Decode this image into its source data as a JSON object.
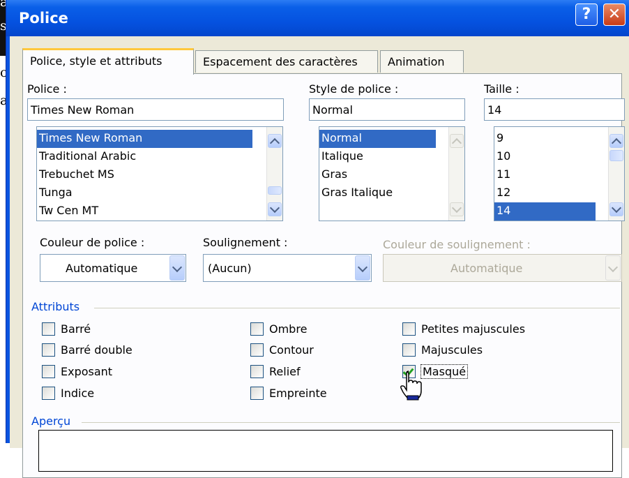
{
  "background": {
    "letters": [
      "a",
      "s",
      "c",
      "a"
    ]
  },
  "window": {
    "title": "Police",
    "help_glyph": "?",
    "close_glyph": "✕"
  },
  "tabs": [
    {
      "label": "Police, style et attributs",
      "active": true
    },
    {
      "label": "Espacement des caractères",
      "active": false
    },
    {
      "label": "Animation",
      "active": false
    }
  ],
  "font": {
    "label": "Police :",
    "value": "Times New Roman",
    "items": [
      "Times New Roman",
      "Traditional Arabic",
      "Trebuchet MS",
      "Tunga",
      "Tw Cen MT"
    ],
    "selected": "Times New Roman"
  },
  "style": {
    "label": "Style de police :",
    "value": "Normal",
    "items": [
      "Normal",
      "Italique",
      "Gras",
      "Gras Italique"
    ],
    "selected": "Normal"
  },
  "size": {
    "label": "Taille :",
    "value": "14",
    "items": [
      "9",
      "10",
      "11",
      "12",
      "14"
    ],
    "selected": "14"
  },
  "font_color": {
    "label": "Couleur de police :",
    "value": "Automatique"
  },
  "underline": {
    "label": "Soulignement :",
    "value": "(Aucun)"
  },
  "underline_color": {
    "label": "Couleur de soulignement :",
    "value": "Automatique",
    "disabled": true
  },
  "attributes": {
    "title": "Attributs",
    "items": [
      {
        "label": "Barré",
        "checked": false
      },
      {
        "label": "Barré double",
        "checked": false
      },
      {
        "label": "Exposant",
        "checked": false
      },
      {
        "label": "Indice",
        "checked": false
      },
      {
        "label": "Ombre",
        "checked": false
      },
      {
        "label": "Contour",
        "checked": false
      },
      {
        "label": "Relief",
        "checked": false
      },
      {
        "label": "Empreinte",
        "checked": false
      },
      {
        "label": "Petites majuscules",
        "checked": false
      },
      {
        "label": "Majuscules",
        "checked": false
      },
      {
        "label": "Masqué",
        "checked": true
      }
    ]
  },
  "preview": {
    "title": "Aperçu"
  },
  "colors": {
    "title_bar": "#0a54e0",
    "selection": "#316ac5",
    "group_title": "#0046d5",
    "active_tab": "#ffc83c"
  },
  "cursor": {
    "icon": "hand-pointer-icon"
  }
}
